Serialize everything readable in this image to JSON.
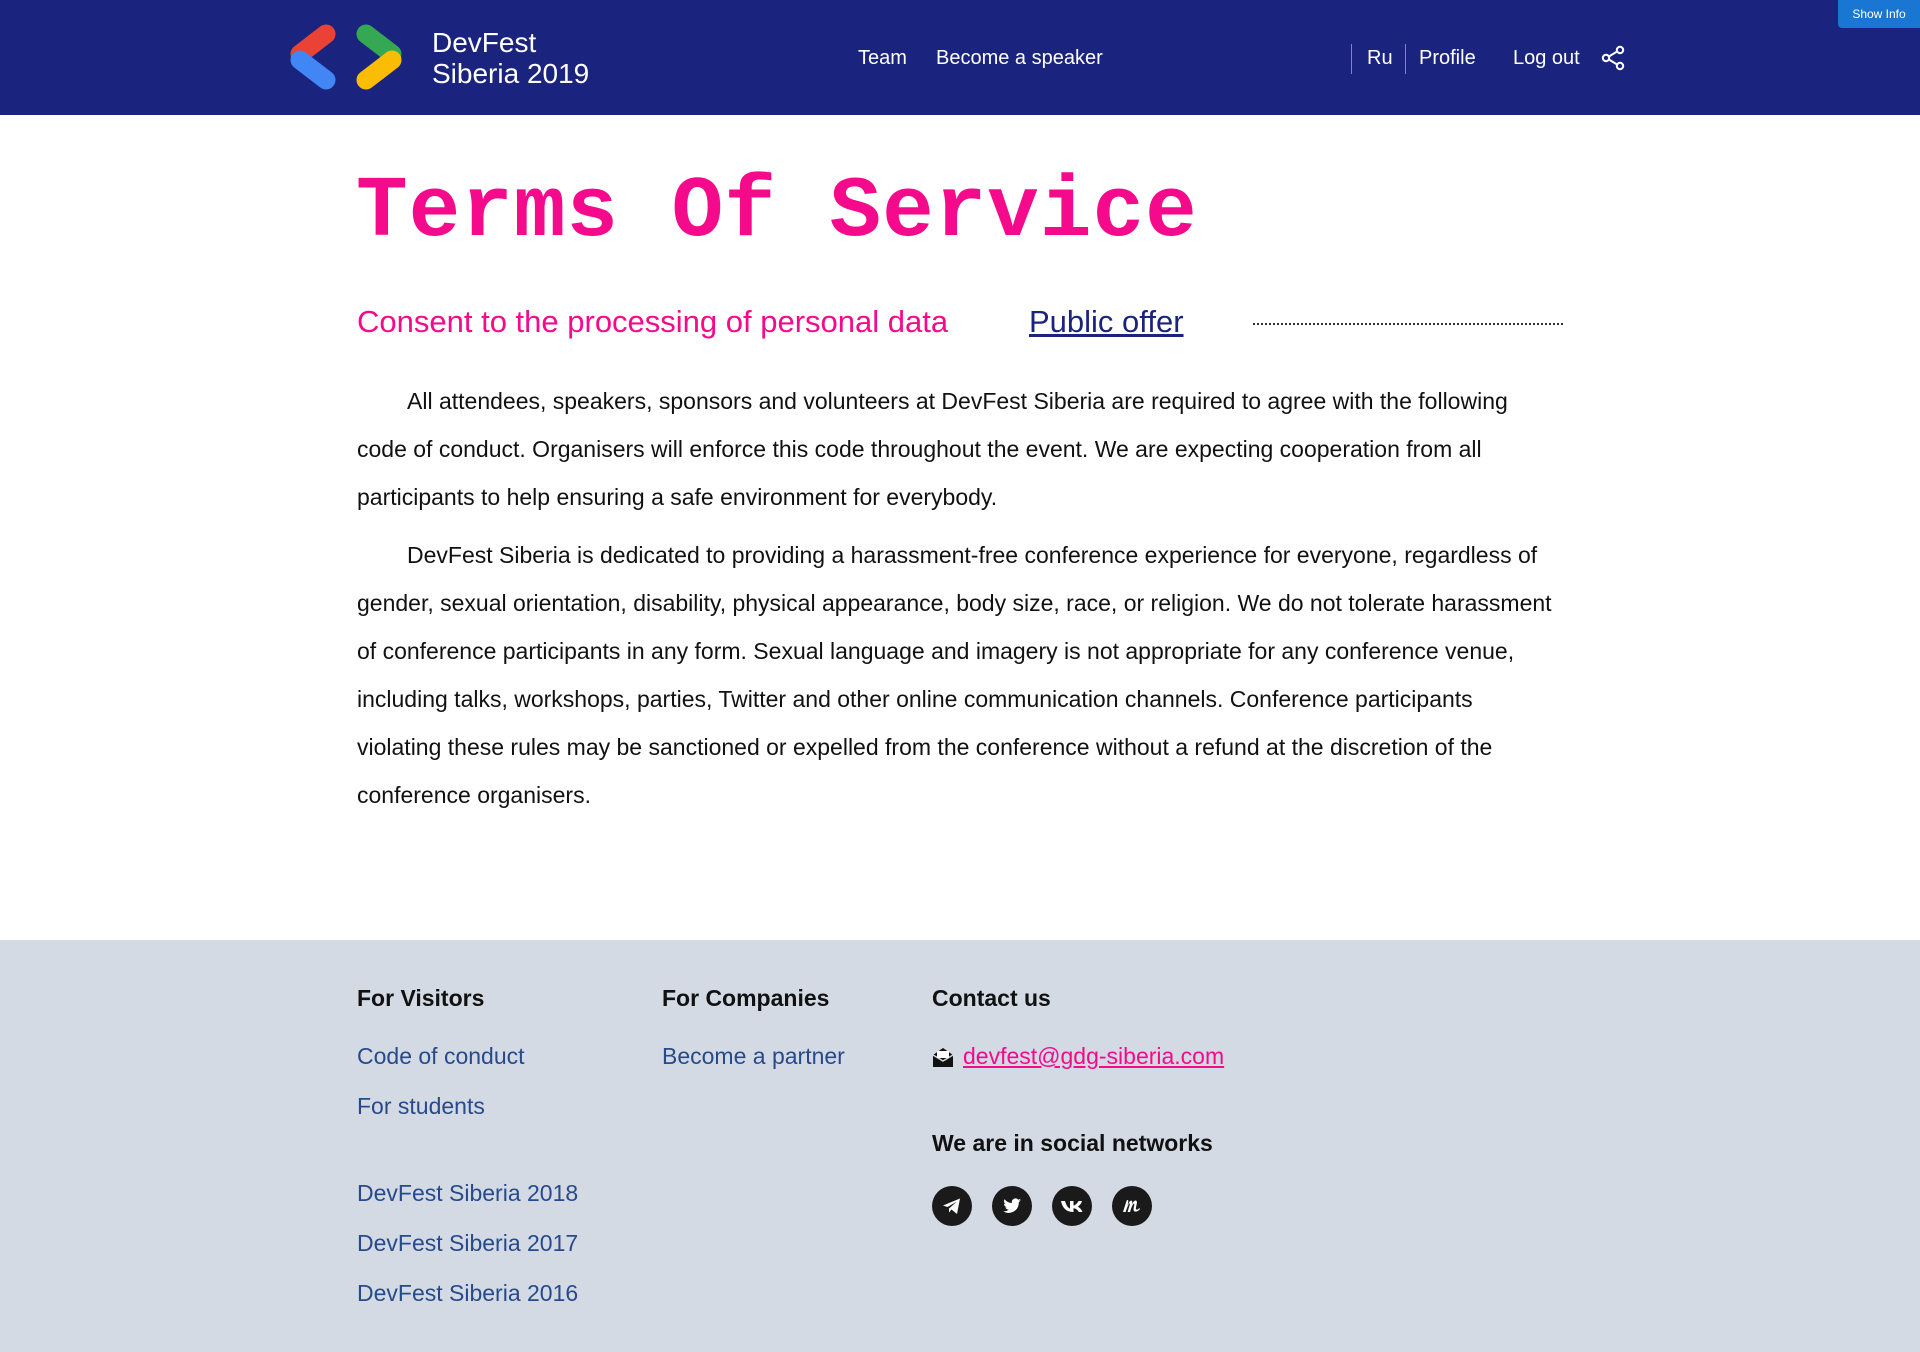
{
  "header": {
    "logo_line1": "DevFest",
    "logo_line2": "Siberia 2019",
    "nav": [
      "Team",
      "Become a speaker"
    ],
    "lang": "Ru",
    "profile": "Profile",
    "logout": "Log out",
    "share_icon": "share-icon",
    "show_info": "Show Info",
    "background_color": "#1a237e"
  },
  "main": {
    "title": "Terms Of Service",
    "tabs": [
      {
        "label": "Consent to the processing of personal data",
        "active": true
      },
      {
        "label": "Public offer",
        "active": false
      }
    ],
    "paragraphs": [
      "All attendees, speakers, sponsors and volunteers at DevFest Siberia are required to agree with the following code of conduct. Organisers will enforce this code throughout the event. We are expecting cooperation from all participants to help ensuring a safe environment for everybody.",
      "DevFest Siberia is dedicated to providing a harassment-free conference experience for everyone, regardless of gender, sexual orientation, disability, physical appearance, body size, race, or religion. We do not tolerate harassment of conference participants in any form. Sexual language and imagery is not appropriate for any conference venue, including talks, workshops, parties, Twitter and other online communication channels. Conference participants violating these rules may be sanctioned or expelled from the conference without a refund at the discretion of the conference organisers."
    ],
    "accent_color": "#f50a8c"
  },
  "footer": {
    "visitors": {
      "heading": "For Visitors",
      "links": [
        "Code of conduct",
        "For students"
      ],
      "archive": [
        "DevFest Siberia 2018",
        "DevFest Siberia 2017",
        "DevFest Siberia 2016"
      ]
    },
    "companies": {
      "heading": "For Companies",
      "links": [
        "Become a partner"
      ]
    },
    "contact": {
      "heading": "Contact us",
      "email": "devfest@gdg-siberia.com",
      "email_icon": "envelope-icon",
      "social_heading": "We are in social networks",
      "social": [
        "telegram-icon",
        "twitter-icon",
        "vk-icon",
        "meetup-icon"
      ]
    },
    "background_color": "#d3dae4"
  }
}
